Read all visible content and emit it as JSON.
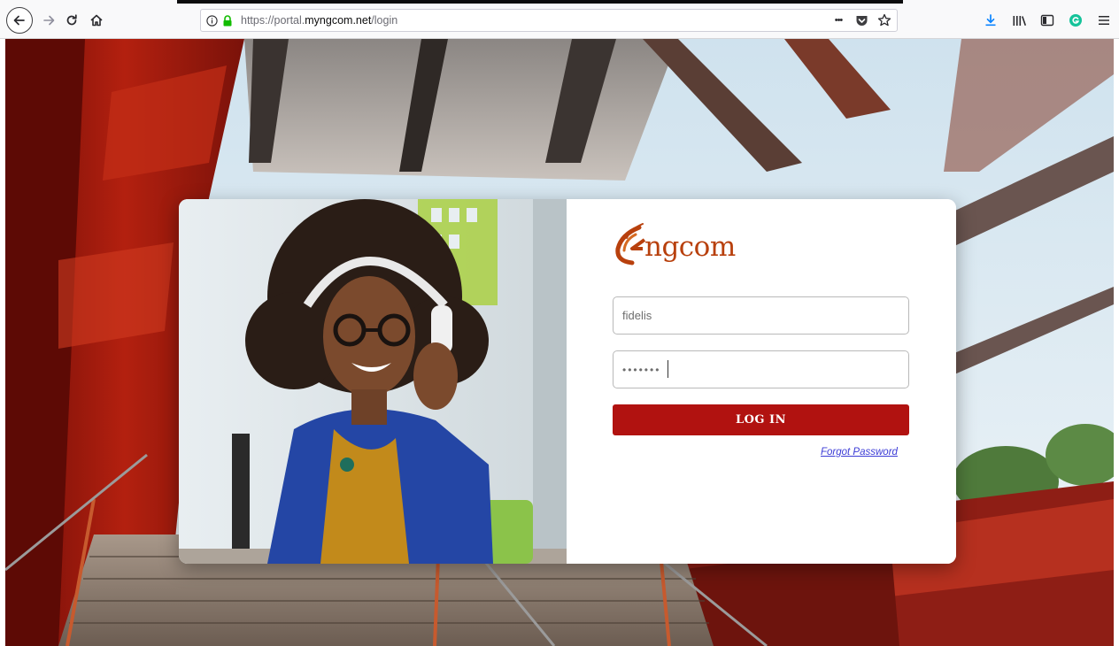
{
  "browser": {
    "url_prefix": "https://portal.",
    "url_domain": "myngcom.net",
    "url_path": "/login",
    "icons": {
      "back": "back-arrow-icon",
      "forward": "forward-arrow-icon",
      "reload": "reload-icon",
      "home": "home-icon",
      "info": "info-icon",
      "lock": "lock-icon",
      "more": "more-actions-icon",
      "pocket": "pocket-icon",
      "bookmark": "bookmark-star-icon",
      "download": "download-icon",
      "library": "library-icon",
      "sidebar": "sidebar-icon",
      "extension": "grammarly-extension-icon",
      "menu": "hamburger-menu-icon"
    },
    "more_glyph": "•••"
  },
  "login": {
    "logo_text": "ngcom",
    "username_value": "fidelis",
    "password_value": "•••••••",
    "login_label": "LOG IN",
    "forgot_label": "Forgot Password"
  },
  "colors": {
    "brand": "#b8400d",
    "button": "#b11210",
    "link": "#3b3bd6",
    "secure_lock": "#12bc00"
  }
}
